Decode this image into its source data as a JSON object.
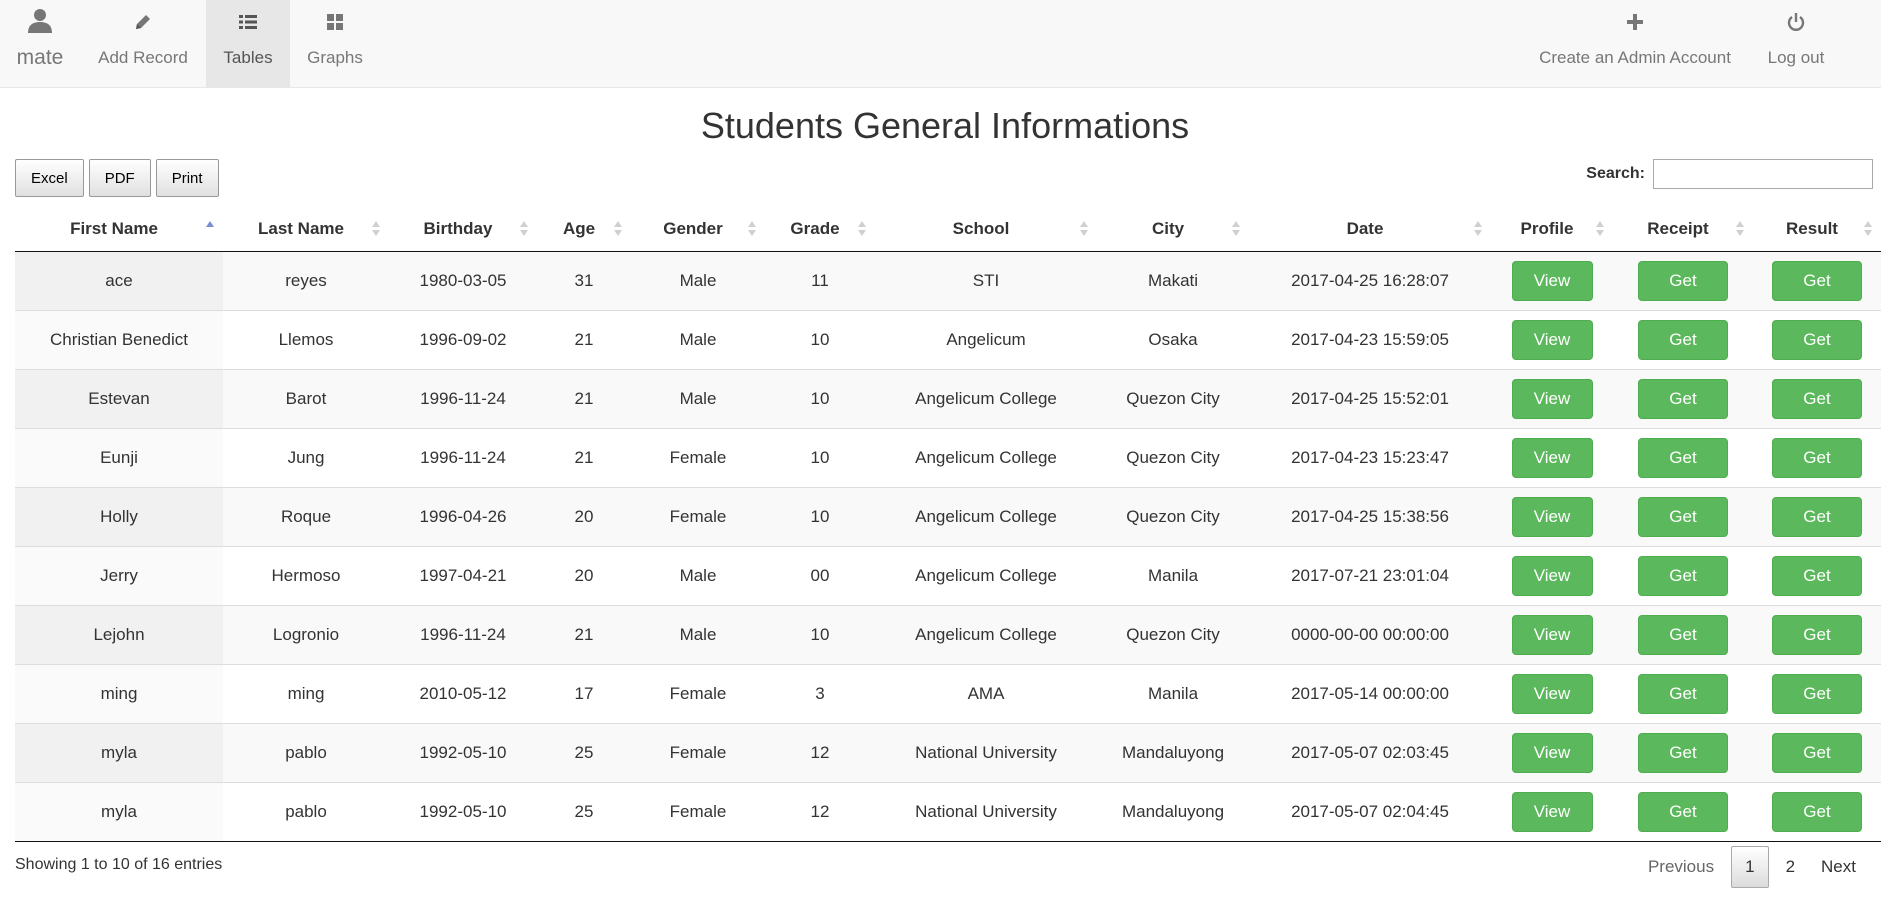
{
  "nav": {
    "brand_label": "mate",
    "items": [
      {
        "label": "Add Record"
      },
      {
        "label": "Tables"
      },
      {
        "label": "Graphs"
      }
    ],
    "right_items": [
      {
        "label": "Create an Admin Account"
      },
      {
        "label": "Log out"
      }
    ]
  },
  "page": {
    "title": "Students General Informations"
  },
  "export_buttons": [
    "Excel",
    "PDF",
    "Print"
  ],
  "search": {
    "label": "Search:",
    "value": ""
  },
  "table": {
    "columns": [
      "First Name",
      "Last Name",
      "Birthday",
      "Age",
      "Gender",
      "Grade",
      "School",
      "City",
      "Date",
      "Profile",
      "Receipt",
      "Result"
    ],
    "sorted_column": "First Name",
    "sort_direction": "asc",
    "view_label": "View",
    "get_label": "Get",
    "rows": [
      [
        "ace",
        "reyes",
        "1980-03-05",
        "31",
        "Male",
        "11",
        "STI",
        "Makati",
        "2017-04-25 16:28:07"
      ],
      [
        "Christian Benedict",
        "Llemos",
        "1996-09-02",
        "21",
        "Male",
        "10",
        "Angelicum",
        "Osaka",
        "2017-04-23 15:59:05"
      ],
      [
        "Estevan",
        "Barot",
        "1996-11-24",
        "21",
        "Male",
        "10",
        "Angelicum College",
        "Quezon City",
        "2017-04-25 15:52:01"
      ],
      [
        "Eunji",
        "Jung",
        "1996-11-24",
        "21",
        "Female",
        "10",
        "Angelicum College",
        "Quezon City",
        "2017-04-23 15:23:47"
      ],
      [
        "Holly",
        "Roque",
        "1996-04-26",
        "20",
        "Female",
        "10",
        "Angelicum College",
        "Quezon City",
        "2017-04-25 15:38:56"
      ],
      [
        "Jerry",
        "Hermoso",
        "1997-04-21",
        "20",
        "Male",
        "00",
        "Angelicum College",
        "Manila",
        "2017-07-21 23:01:04"
      ],
      [
        "Lejohn",
        "Logronio",
        "1996-11-24",
        "21",
        "Male",
        "10",
        "Angelicum College",
        "Quezon City",
        "0000-00-00 00:00:00"
      ],
      [
        "ming",
        "ming",
        "2010-05-12",
        "17",
        "Female",
        "3",
        "AMA",
        "Manila",
        "2017-05-14 00:00:00"
      ],
      [
        "myla",
        "pablo",
        "1992-05-10",
        "25",
        "Female",
        "12",
        "National University",
        "Mandaluyong",
        "2017-05-07 02:03:45"
      ],
      [
        "myla",
        "pablo",
        "1992-05-10",
        "25",
        "Female",
        "12",
        "National University",
        "Mandaluyong",
        "2017-05-07 02:04:45"
      ]
    ]
  },
  "footer": {
    "info": "Showing 1 to 10 of 16 entries",
    "pagination": {
      "previous": "Previous",
      "pages": [
        "1",
        "2"
      ],
      "current": "1",
      "next": "Next"
    }
  },
  "colors": {
    "accent_green": "#5cb85c",
    "navbar_bg": "#f8f8f8",
    "active_nav_bg": "#e7e7e7"
  }
}
